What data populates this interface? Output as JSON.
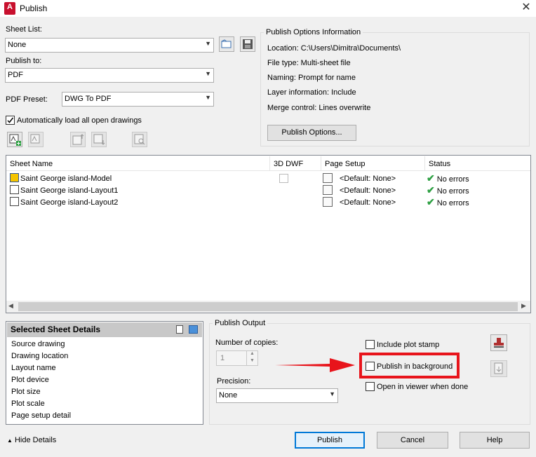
{
  "window": {
    "title": "Publish",
    "app_icon": "A",
    "close_glyph": "✕"
  },
  "sheet_list": {
    "label": "Sheet List:",
    "value": "None"
  },
  "publish_to": {
    "label": "Publish to:",
    "value": "PDF"
  },
  "pdf_preset": {
    "label": "PDF Preset:",
    "value": "DWG To PDF"
  },
  "auto_load": {
    "label": "Automatically load all open drawings",
    "checked": true
  },
  "options_info": {
    "title": "Publish Options Information",
    "location": "Location:  C:\\Users\\Dimitra\\Documents\\",
    "file_type": "File type:  Multi-sheet file",
    "naming": "Naming:  Prompt for name",
    "layer_info": "Layer information:  Include",
    "merge": "Merge control:  Lines overwrite",
    "button": "Publish Options..."
  },
  "table": {
    "headers": {
      "sheet_name": "Sheet Name",
      "dwf": "3D DWF",
      "page_setup": "Page Setup",
      "status": "Status"
    },
    "rows": [
      {
        "name": "Saint George island-Model",
        "page_setup": "<Default: None>",
        "status": "No errors",
        "type": "model"
      },
      {
        "name": "Saint George island-Layout1",
        "page_setup": "<Default: None>",
        "status": "No errors",
        "type": "layout"
      },
      {
        "name": "Saint George island-Layout2",
        "page_setup": "<Default: None>",
        "status": "No errors",
        "type": "layout"
      }
    ]
  },
  "details": {
    "title": "Selected Sheet Details",
    "items": [
      "Source drawing",
      "Drawing location",
      "Layout name",
      "Plot device",
      "Plot size",
      "Plot scale",
      "Page setup detail"
    ]
  },
  "publish_output": {
    "title": "Publish Output",
    "copies_label": "Number of copies:",
    "copies_value": "1",
    "precision_label": "Precision:",
    "precision_value": "None",
    "include_stamp": "Include plot stamp",
    "background": "Publish in background",
    "open_viewer": "Open in viewer when done"
  },
  "footer": {
    "hide_details": "Hide Details",
    "publish": "Publish",
    "cancel": "Cancel",
    "help": "Help"
  },
  "annotation": {
    "highlight_color": "#e8141b"
  }
}
